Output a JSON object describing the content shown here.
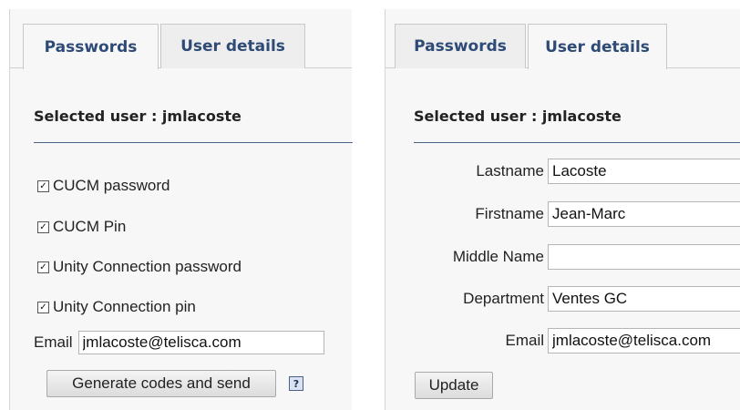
{
  "left_panel": {
    "tabs": [
      "Passwords",
      "User details"
    ],
    "selected_user": "Selected user : jmlacoste",
    "options": [
      {
        "label": "CUCM password",
        "checked": true
      },
      {
        "label": "CUCM Pin",
        "checked": true
      },
      {
        "label": "Unity Connection password",
        "checked": true
      },
      {
        "label": "Unity Connection pin",
        "checked": true
      }
    ],
    "email_label": "Email",
    "email_value": "jmlacoste@telisca.com",
    "generate_button": "Generate codes and send",
    "help_glyph": "?"
  },
  "right_panel": {
    "tabs": [
      "Passwords",
      "User details"
    ],
    "selected_user": "Selected user : jmlacoste",
    "fields": [
      {
        "label": "Lastname",
        "value": "Lacoste"
      },
      {
        "label": "Firstname",
        "value": "Jean-Marc"
      },
      {
        "label": "Middle Name",
        "value": ""
      },
      {
        "label": "Department",
        "value": "Ventes GC"
      },
      {
        "label": "Email",
        "value": "jmlacoste@telisca.com"
      }
    ],
    "update_button": "Update"
  },
  "colors": {
    "tab_text": "#2e4a77",
    "rule": "#4b6486",
    "panel_bg": "#f7f7f7"
  }
}
